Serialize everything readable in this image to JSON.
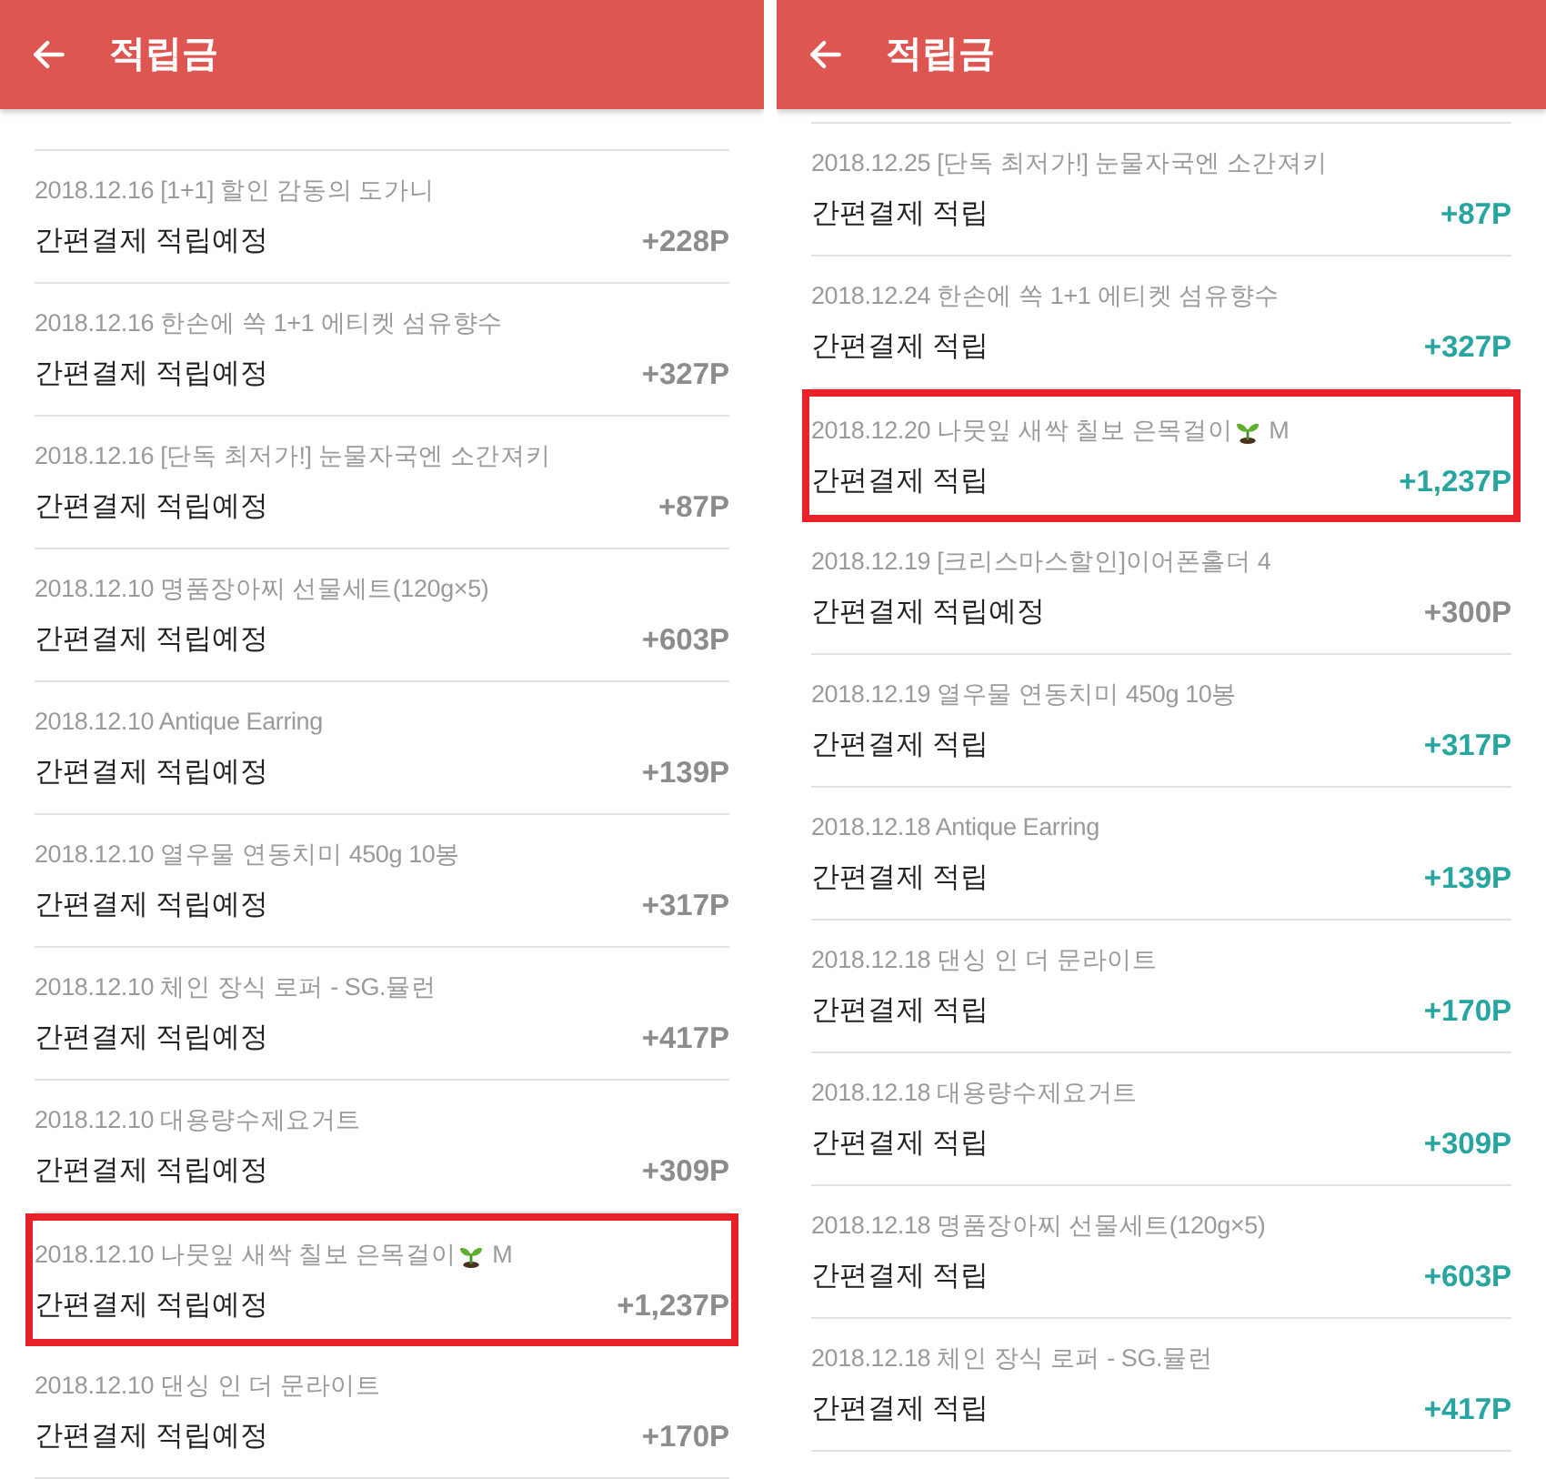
{
  "panels": [
    {
      "header": {
        "title": "적립금"
      },
      "items": [
        {
          "title": "2018.12.16 [1+1] 할인 감동의 도가니",
          "label": "간편결제 적립예정",
          "amount": "+228P",
          "pending": true,
          "highlighted": false
        },
        {
          "title": "2018.12.16 한손에 쏙 1+1 에티켓 섬유향수",
          "label": "간편결제 적립예정",
          "amount": "+327P",
          "pending": true,
          "highlighted": false
        },
        {
          "title": "2018.12.16 [단독 최저가!] 눈물자국엔 소간져키",
          "label": "간편결제 적립예정",
          "amount": "+87P",
          "pending": true,
          "highlighted": false
        },
        {
          "title": "2018.12.10 명품장아찌 선물세트(120g×5)",
          "label": "간편결제 적립예정",
          "amount": "+603P",
          "pending": true,
          "highlighted": false
        },
        {
          "title": "2018.12.10 Antique Earring",
          "label": "간편결제 적립예정",
          "amount": "+139P",
          "pending": true,
          "highlighted": false
        },
        {
          "title": "2018.12.10 열우물 연동치미 450g 10봉",
          "label": "간편결제 적립예정",
          "amount": "+317P",
          "pending": true,
          "highlighted": false
        },
        {
          "title": "2018.12.10 체인 장식 로퍼 - SG.뮬런",
          "label": "간편결제 적립예정",
          "amount": "+417P",
          "pending": true,
          "highlighted": false
        },
        {
          "title": "2018.12.10 대용량수제요거트",
          "label": "간편결제 적립예정",
          "amount": "+309P",
          "pending": true,
          "highlighted": false
        },
        {
          "title": "2018.12.10 나뭇잎 새싹 칠보 은목걸이",
          "emoji": true,
          "title_suffix": "M",
          "label": "간편결제 적립예정",
          "amount": "+1,237P",
          "pending": true,
          "highlighted": true
        },
        {
          "title": "2018.12.10 댄싱 인 더 문라이트",
          "label": "간편결제 적립예정",
          "amount": "+170P",
          "pending": true,
          "highlighted": false
        }
      ]
    },
    {
      "header": {
        "title": "적립금"
      },
      "items": [
        {
          "title": "2018.12.25 [단독 최저가!] 눈물자국엔 소간져키",
          "label": "간편결제 적립",
          "amount": "+87P",
          "pending": false,
          "highlighted": false
        },
        {
          "title": "2018.12.24 한손에 쏙 1+1 에티켓 섬유향수",
          "label": "간편결제 적립",
          "amount": "+327P",
          "pending": false,
          "highlighted": false
        },
        {
          "title": "2018.12.20 나뭇잎 새싹 칠보 은목걸이",
          "emoji": true,
          "title_suffix": "M",
          "label": "간편결제 적립",
          "amount": "+1,237P",
          "pending": false,
          "highlighted": true
        },
        {
          "title": "2018.12.19 [크리스마스할인]이어폰홀더 4",
          "label": "간편결제 적립예정",
          "amount": "+300P",
          "pending": true,
          "highlighted": false
        },
        {
          "title": "2018.12.19 열우물 연동치미 450g 10봉",
          "label": "간편결제 적립",
          "amount": "+317P",
          "pending": false,
          "highlighted": false
        },
        {
          "title": "2018.12.18 Antique Earring",
          "label": "간편결제 적립",
          "amount": "+139P",
          "pending": false,
          "highlighted": false
        },
        {
          "title": "2018.12.18 댄싱 인 더 문라이트",
          "label": "간편결제 적립",
          "amount": "+170P",
          "pending": false,
          "highlighted": false
        },
        {
          "title": "2018.12.18 대용량수제요거트",
          "label": "간편결제 적립",
          "amount": "+309P",
          "pending": false,
          "highlighted": false
        },
        {
          "title": "2018.12.18 명품장아찌 선물세트(120g×5)",
          "label": "간편결제 적립",
          "amount": "+603P",
          "pending": false,
          "highlighted": false
        },
        {
          "title": "2018.12.18 체인 장식 로퍼 - SG.뮬런",
          "label": "간편결제 적립",
          "amount": "+417P",
          "pending": false,
          "highlighted": false
        }
      ]
    }
  ]
}
